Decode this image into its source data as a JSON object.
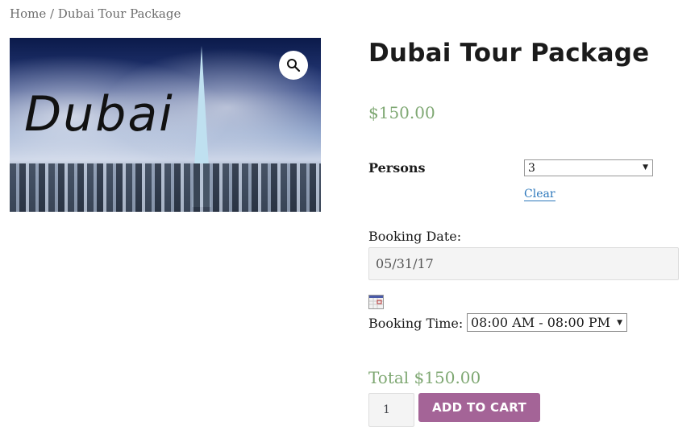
{
  "breadcrumb": {
    "text": "Home / Dubai Tour Package"
  },
  "product": {
    "title": "Dubai Tour Package",
    "price": "$150.00",
    "image_text": "Dubai",
    "zoom_icon": "magnifier-icon"
  },
  "form": {
    "persons_label": "Persons",
    "persons_value": "3",
    "clear_label": "Clear",
    "date_label": "Booking Date:",
    "date_value": "05/31/17",
    "calendar_icon": "calendar-icon",
    "time_label": "Booking Time:",
    "time_value": "08:00 AM - 08:00 PM",
    "total": "Total $150.00",
    "quantity": "1",
    "add_to_cart_label": "ADD TO CART"
  },
  "colors": {
    "price": "#7fa873",
    "button": "#a46497",
    "link": "#2c77bb"
  }
}
